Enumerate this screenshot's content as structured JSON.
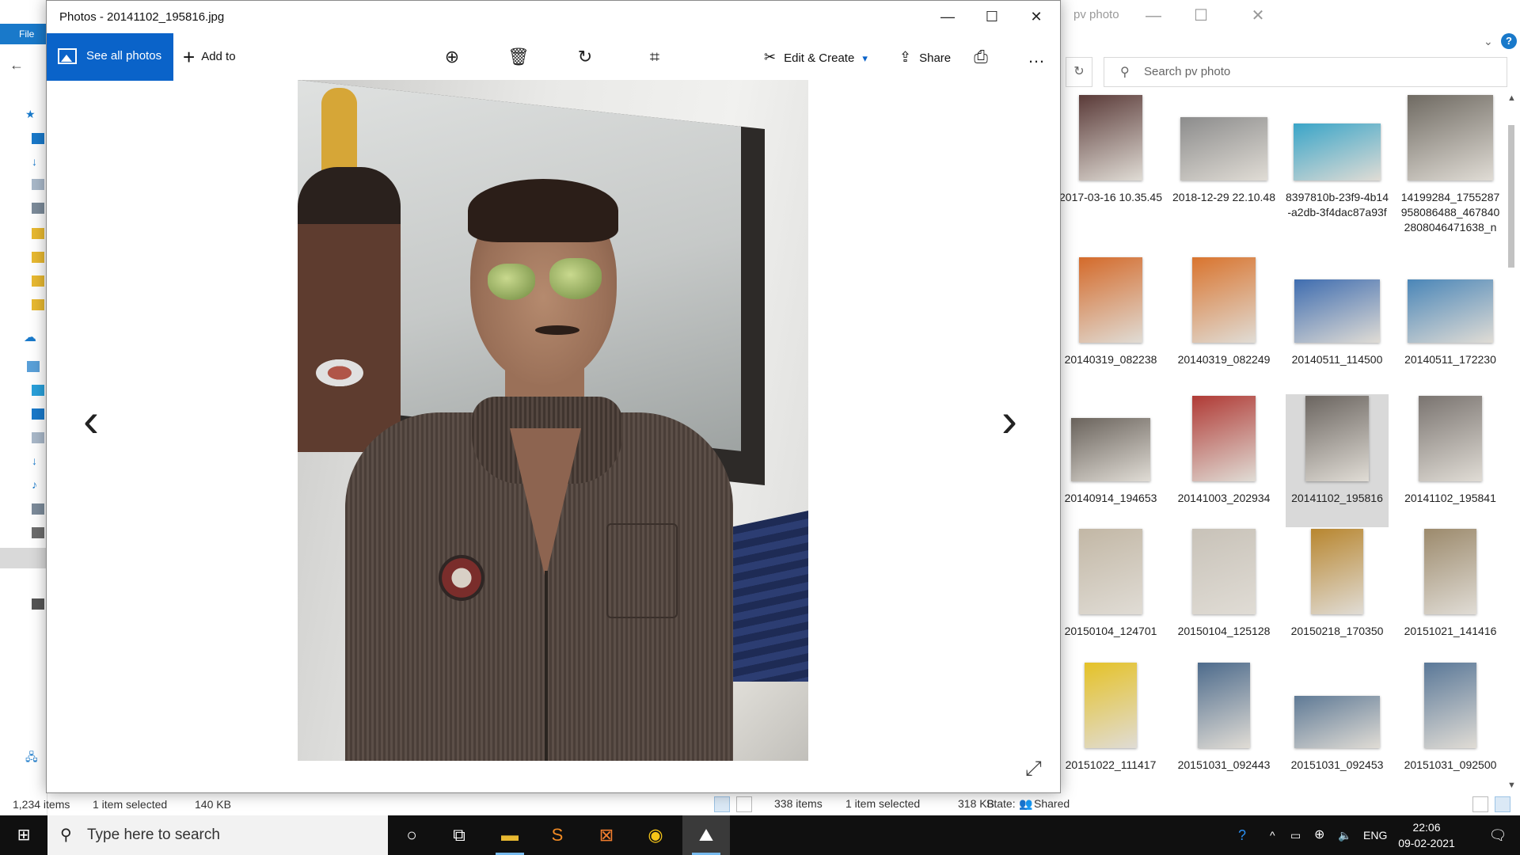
{
  "photos": {
    "title": "Photos - 20141102_195816.jpg",
    "see_all_label": "See all photos",
    "add_to_label": "Add to",
    "edit_create_label": "Edit & Create",
    "share_label": "Share",
    "more_label": "…"
  },
  "left_explorer": {
    "file_tab": "File",
    "status_items": "1,234 items",
    "status_selected": "1 item selected",
    "status_size": "140 KB"
  },
  "right_explorer": {
    "title": "pv photo",
    "search_placeholder": "Search pv photo",
    "status_items": "338 items",
    "status_selected": "1 item selected",
    "status_size": "318 KB",
    "status_state_label": "State:",
    "status_state_value": "Shared",
    "files": [
      {
        "name": "2017-03-16 10.35.45",
        "color": "#5a3a38"
      },
      {
        "name": "2018-12-29 22.10.48",
        "color": "#8c8c8c"
      },
      {
        "name": "8397810b-23f9-4b14-a2db-3f4dac87a93f",
        "color": "#3aa5c8"
      },
      {
        "name": "14199284_1755287958086488_4678402808046471638_n",
        "color": "#6f6a62"
      },
      {
        "name": "20140319_082238",
        "color": "#d46a2a"
      },
      {
        "name": "20140319_082249",
        "color": "#d9742e"
      },
      {
        "name": "20140511_114500",
        "color": "#3f6db0"
      },
      {
        "name": "20140511_172230",
        "color": "#4a86b8"
      },
      {
        "name": "20140914_194653",
        "color": "#6a635c"
      },
      {
        "name": "20141003_202934",
        "color": "#b03a35"
      },
      {
        "name": "20141102_195816",
        "color": "#6b6560"
      },
      {
        "name": "20141102_195841",
        "color": "#7a7470"
      },
      {
        "name": "20150104_124701",
        "color": "#c2b7a5"
      },
      {
        "name": "20150104_125128",
        "color": "#c8c2b8"
      },
      {
        "name": "20150218_170350",
        "color": "#b8862f"
      },
      {
        "name": "20151021_141416",
        "color": "#9c8a6c"
      },
      {
        "name": "20151022_111417",
        "color": "#e5c227"
      },
      {
        "name": "20151031_092443",
        "color": "#4d6b8c"
      },
      {
        "name": "20151031_092453",
        "color": "#5f7a96"
      },
      {
        "name": "20151031_092500",
        "color": "#5a7898"
      }
    ]
  },
  "taskbar": {
    "search_placeholder": "Type here to search",
    "language": "ENG",
    "time": "22:06",
    "date": "09-02-2021"
  },
  "colors": {
    "accent": "#0a63c9",
    "taskbar": "#101010"
  }
}
